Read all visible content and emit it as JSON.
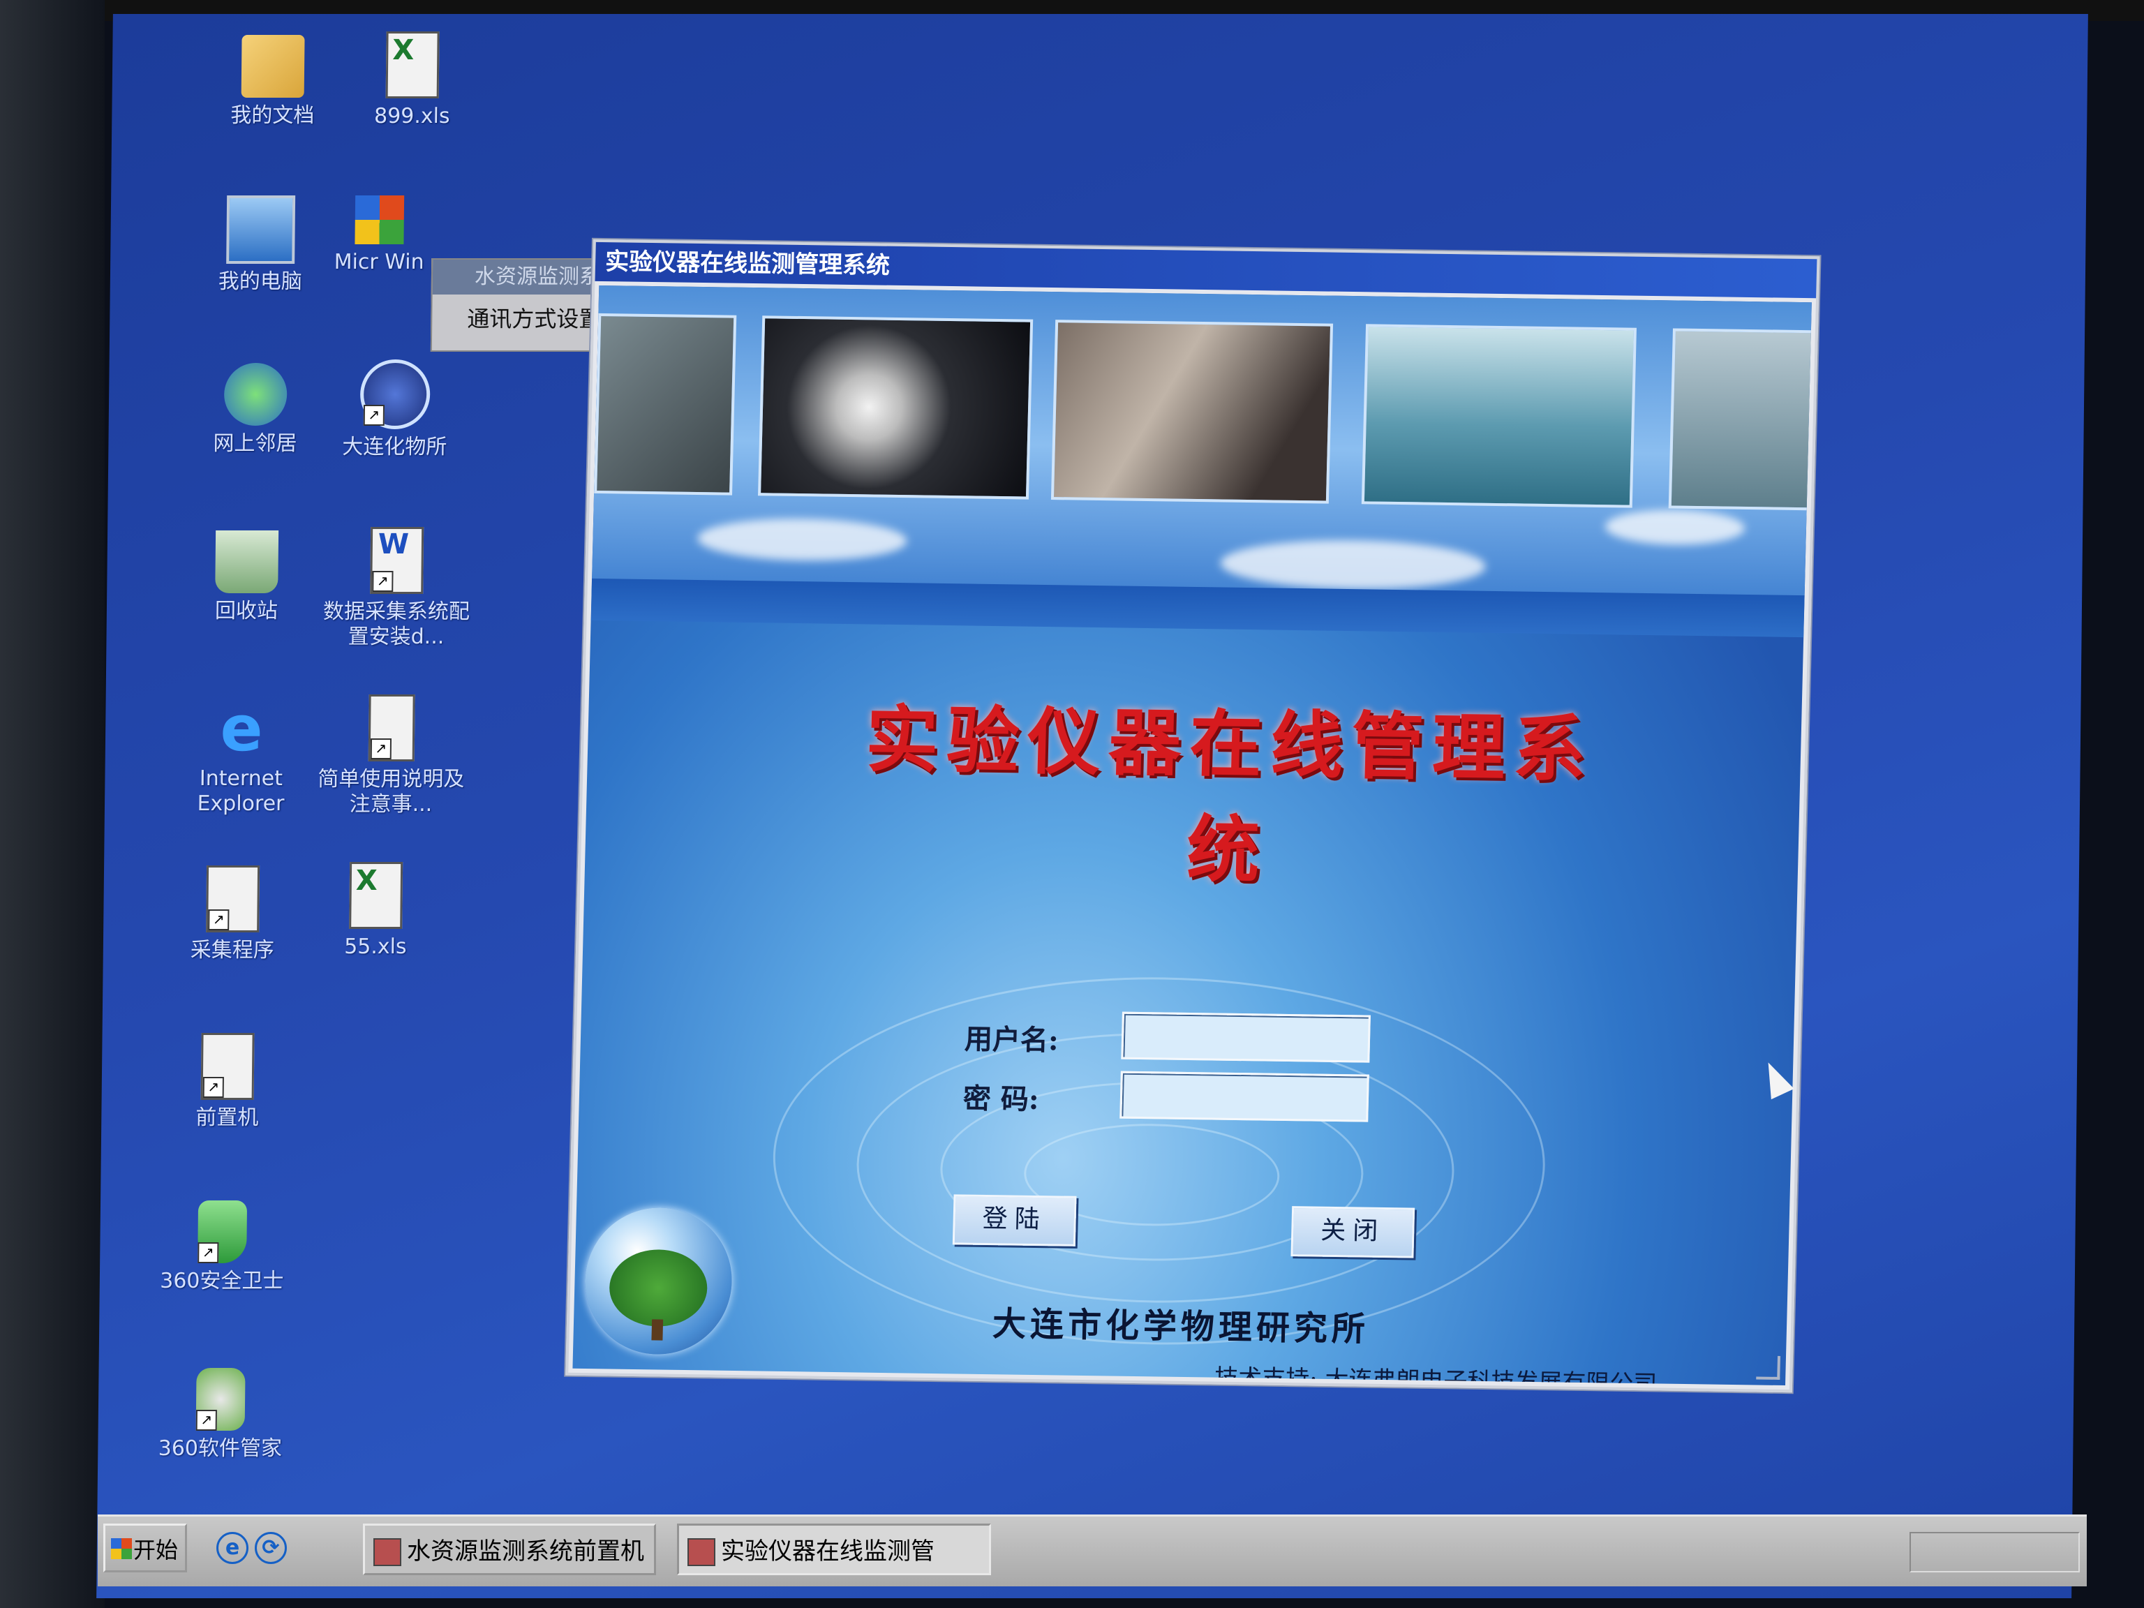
{
  "desktop": {
    "icons": [
      {
        "label": "我的文档"
      },
      {
        "label": "899.xls"
      },
      {
        "label": "我的电脑"
      },
      {
        "label": "Micr Win"
      },
      {
        "label": "网上邻居"
      },
      {
        "label": "大连化物所"
      },
      {
        "label": "回收站"
      },
      {
        "label": "数据采集系统配置安装d..."
      },
      {
        "label": "Internet Explorer"
      },
      {
        "label": "简单使用说明及注意事..."
      },
      {
        "label": "采集程序"
      },
      {
        "label": "55.xls"
      },
      {
        "label": "前置机"
      },
      {
        "label": "360安全卫士"
      },
      {
        "label": "360软件管家"
      }
    ]
  },
  "context_menu": {
    "title": "水资源监测系",
    "item": "通讯方式设置"
  },
  "window": {
    "title": "实验仪器在线监测管理系统",
    "banner_title": "实验仪器在线管理系统",
    "username_label": "用户名:",
    "password_label": "密  码:",
    "username_value": "",
    "password_value": "",
    "login_button": "登陆",
    "close_button": "关闭",
    "organization": "大连市化学物理研究所",
    "tech_support": "技术支持: 大连弗朗电子科技发展有限公司"
  },
  "taskbar": {
    "start_label": "开始",
    "tasks": [
      {
        "label": "水资源监测系统前置机"
      },
      {
        "label": "实验仪器在线监测管"
      }
    ]
  }
}
